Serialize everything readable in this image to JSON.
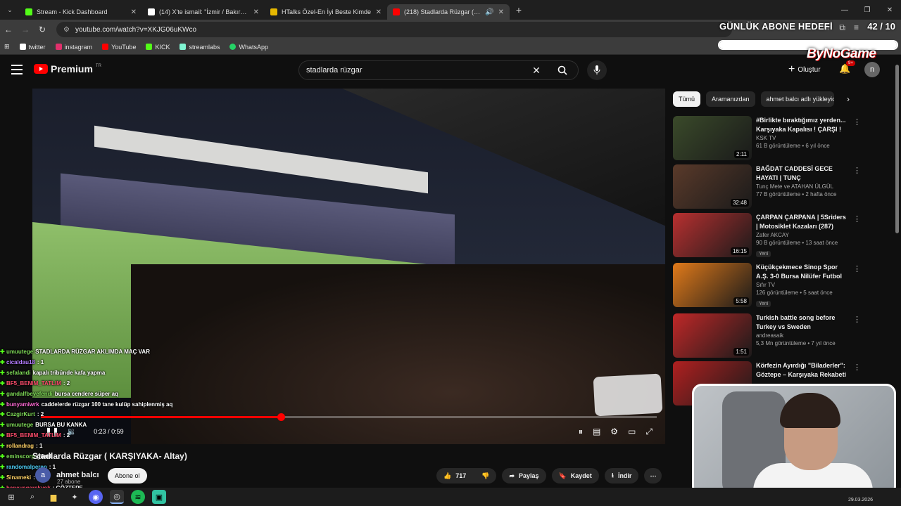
{
  "browser": {
    "tabs": [
      {
        "title": "Stream - Kick Dashboard",
        "color": "#53fc18"
      },
      {
        "title": "(14) X'te ismail: \"İzmir / Bakırçay",
        "color": "#ffffff"
      },
      {
        "title": "HTalks Özel-En İyi Beste Kimde",
        "color": "#e6b800"
      },
      {
        "title": "(218) Stadlarda Rüzgar ( KA",
        "color": "#ff0000"
      }
    ],
    "url": "youtube.com/watch?v=XKJG06uKWco",
    "bookmarks": [
      {
        "label": "twitter",
        "color": "#ffffff"
      },
      {
        "label": "instagram",
        "color": "#e1306c"
      },
      {
        "label": "YouTube",
        "color": "#ff0000"
      },
      {
        "label": "KICK",
        "color": "#53fc18"
      },
      {
        "label": "streamlabs",
        "color": "#80f5d2"
      },
      {
        "label": "WhatsApp",
        "color": "#25d366"
      }
    ]
  },
  "overlay": {
    "goal_title": "GÜNLÜK ABONE HEDEFİ",
    "goal_count": "42 / 10",
    "goal_progress": 1.0,
    "brand": "ByNoGame"
  },
  "youtube": {
    "logo": "Premium",
    "logo_sup": "TR",
    "search_value": "stadlarda rüzgar",
    "create_label": "Oluştur",
    "notif_badge": "9+",
    "avatar_letter": "n"
  },
  "player": {
    "time": "0:23 / 0:59",
    "progress": 0.39
  },
  "chat": [
    {
      "user": "umuutege",
      "text": "STADLARDA RÜZGAR AKLIMDA MAÇ VAR",
      "color": "#7ed957"
    },
    {
      "user": "cicaldau18",
      "text": ": 1",
      "color": "#b47cff"
    },
    {
      "user": "sefalandi",
      "text": "kapalı tribünde kafa yapma",
      "color": "#7ed957"
    },
    {
      "user": "BF5_BENIM_TATLIM",
      "text": ": 2",
      "color": "#ff4d6d"
    },
    {
      "user": "gandalfbeyefendi",
      "text": "bursa cendere süper aq",
      "color": "#7ed957"
    },
    {
      "user": "bunyamiwrk",
      "text": "caddelerde rüzgar 100 tane kulüp sahiplenmiş aq",
      "color": "#ff6ad5"
    },
    {
      "user": "CazgirKurt",
      "text": ": 2",
      "color": "#7ed957"
    },
    {
      "user": "umuutege",
      "text": "BURSA BU KANKA",
      "color": "#7ed957"
    },
    {
      "user": "BF5_BENIM_TATLIM",
      "text": ": 2",
      "color": "#ff4d6d"
    },
    {
      "user": "rollandrag",
      "text": ": 1",
      "color": "#ffd166"
    },
    {
      "user": "eminscorp",
      "text": "güzel",
      "color": "#7ed957"
    },
    {
      "user": "randomalperen",
      "text": ": 1",
      "color": "#4cc9f0"
    },
    {
      "user": "Sinameki",
      "text": ": 2",
      "color": "#ffd166"
    },
    {
      "user": "haneyegerekyok",
      "text": ": GÖZTEPE",
      "color": "#ff4d6d"
    }
  ],
  "video": {
    "title": "Stadlarda Rüzgar ( KARŞIYAKA- Altay)",
    "channel": "ahmet balcı",
    "channel_initial": "a",
    "subs": "27 abone",
    "subscribe": "Abone ol",
    "likes": "717",
    "share": "Paylaş",
    "save": "Kaydet",
    "download": "İndir"
  },
  "chips": [
    "Tümü",
    "Aramanızdan",
    "ahmet balcı adlı yükleyici"
  ],
  "recs": [
    {
      "title": "#Birlikte bıraktığımız yerden... Karşıyaka Kapalısı ! ÇARŞI !",
      "channel": "KSK TV",
      "stats": "61 B görüntüleme • 6 yıl önce",
      "duration": "2:11",
      "new": "",
      "thumb": "#3a4a2a"
    },
    {
      "title": "BAĞDAT CADDESİ GECE HAYATI | TUNÇ METE,ATAHAN...",
      "channel": "Tunç Mete ve ATAHAN ÜLGÜL",
      "stats": "77 B görüntüleme • 2 hafta önce",
      "duration": "32:48",
      "new": "",
      "thumb": "#5a3a2a"
    },
    {
      "title": "ÇARPAN ÇARPANA | 5Sriders | Motosiklet Kazaları (287)",
      "channel": "Zafer AKCAY",
      "stats": "90 B görüntüleme • 13 saat önce",
      "duration": "16:15",
      "new": "Yeni",
      "thumb": "#b83030"
    },
    {
      "title": "Küçükçekmece Sinop Spor A.Ş. 3-0 Bursa Nilüfer Futbol A.Ş. | ...",
      "channel": "Sıfır TV",
      "stats": "126 görüntüleme • 5 saat önce",
      "duration": "5:58",
      "new": "Yeni",
      "thumb": "#e07a1a"
    },
    {
      "title": "Turkish battle song before Turkey vs Sweden",
      "channel": "andreasaik",
      "stats": "5,3 Mn görüntüleme • 7 yıl önce",
      "duration": "1:51",
      "new": "",
      "thumb": "#c02828"
    },
    {
      "title": "Körfezin Ayırdığı \"Biladerler\": Göztepe – Karşıyaka Rekabeti ...",
      "channel": "",
      "stats": "",
      "duration": "",
      "new": "",
      "thumb": "#b02020"
    }
  ],
  "clock": "29.03.2026"
}
